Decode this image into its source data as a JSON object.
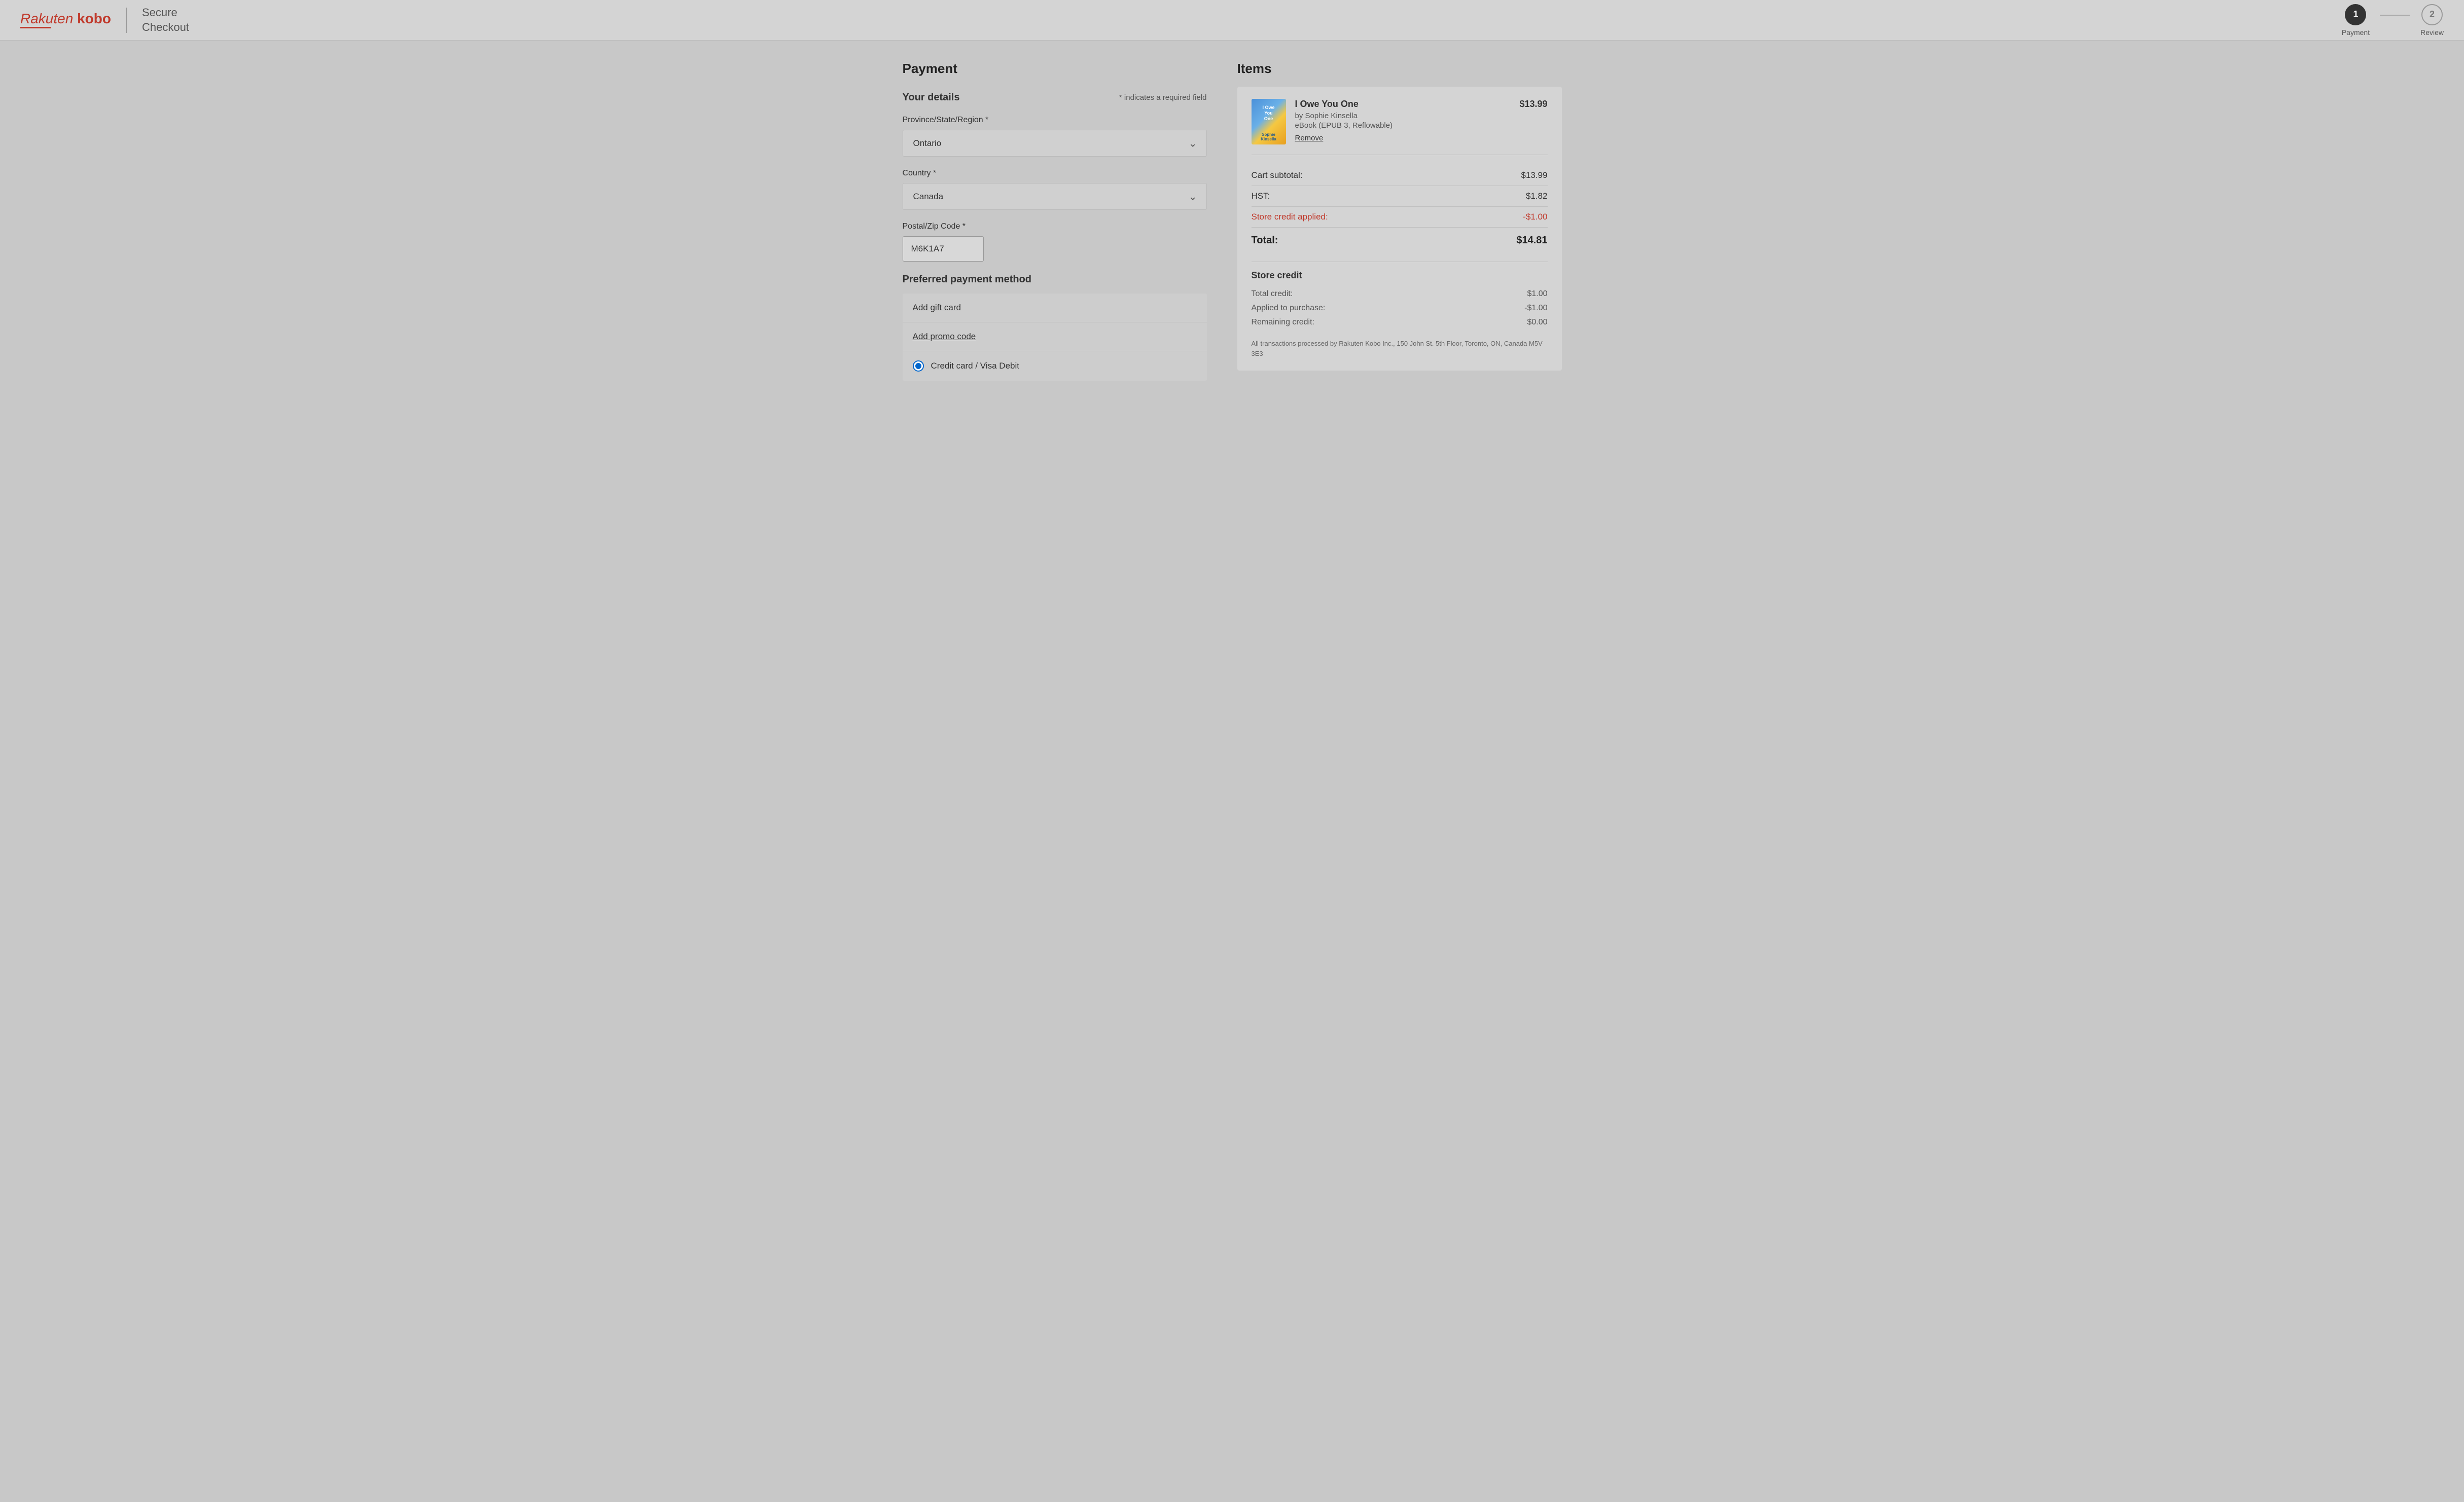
{
  "header": {
    "logo_rakuten": "Rakuten",
    "logo_kobo": "kobo",
    "secure_checkout": "Secure\nCheckout",
    "step1_number": "1",
    "step1_label": "Payment",
    "step2_number": "2",
    "step2_label": "Review"
  },
  "payment": {
    "section_title": "Payment",
    "your_details_title": "Your details",
    "required_note": "* indicates a required field",
    "province_label": "Province/State/Region *",
    "province_value": "Ontario",
    "country_label": "Country *",
    "country_value": "Canada",
    "postal_label": "Postal/Zip Code *",
    "postal_value": "M6K1A7",
    "preferred_payment_title": "Preferred payment method",
    "add_gift_card_label": "Add gift card",
    "add_promo_label": "Add promo code",
    "credit_card_label": "Credit card / Visa Debit"
  },
  "items": {
    "section_title": "Items",
    "book": {
      "title": "I Owe You One",
      "author": "by Sophie Kinsella",
      "format": "eBook (EPUB 3, Reflowable)",
      "price": "$13.99",
      "remove_label": "Remove",
      "cover_text": "I Owe\nYou\nOne"
    },
    "cart_subtotal_label": "Cart subtotal:",
    "cart_subtotal_value": "$13.99",
    "hst_label": "HST:",
    "hst_value": "$1.82",
    "store_credit_applied_label": "Store credit applied:",
    "store_credit_applied_value": "-$1.00",
    "total_label": "Total:",
    "total_value": "$14.81",
    "store_credit_section_title": "Store credit",
    "total_credit_label": "Total credit:",
    "total_credit_value": "$1.00",
    "applied_label": "Applied to purchase:",
    "applied_value": "-$1.00",
    "remaining_label": "Remaining credit:",
    "remaining_value": "$0.00",
    "transaction_note": "All transactions processed by Rakuten Kobo Inc., 150 John St. 5th Floor, Toronto, ON, Canada M5V 3E3"
  }
}
